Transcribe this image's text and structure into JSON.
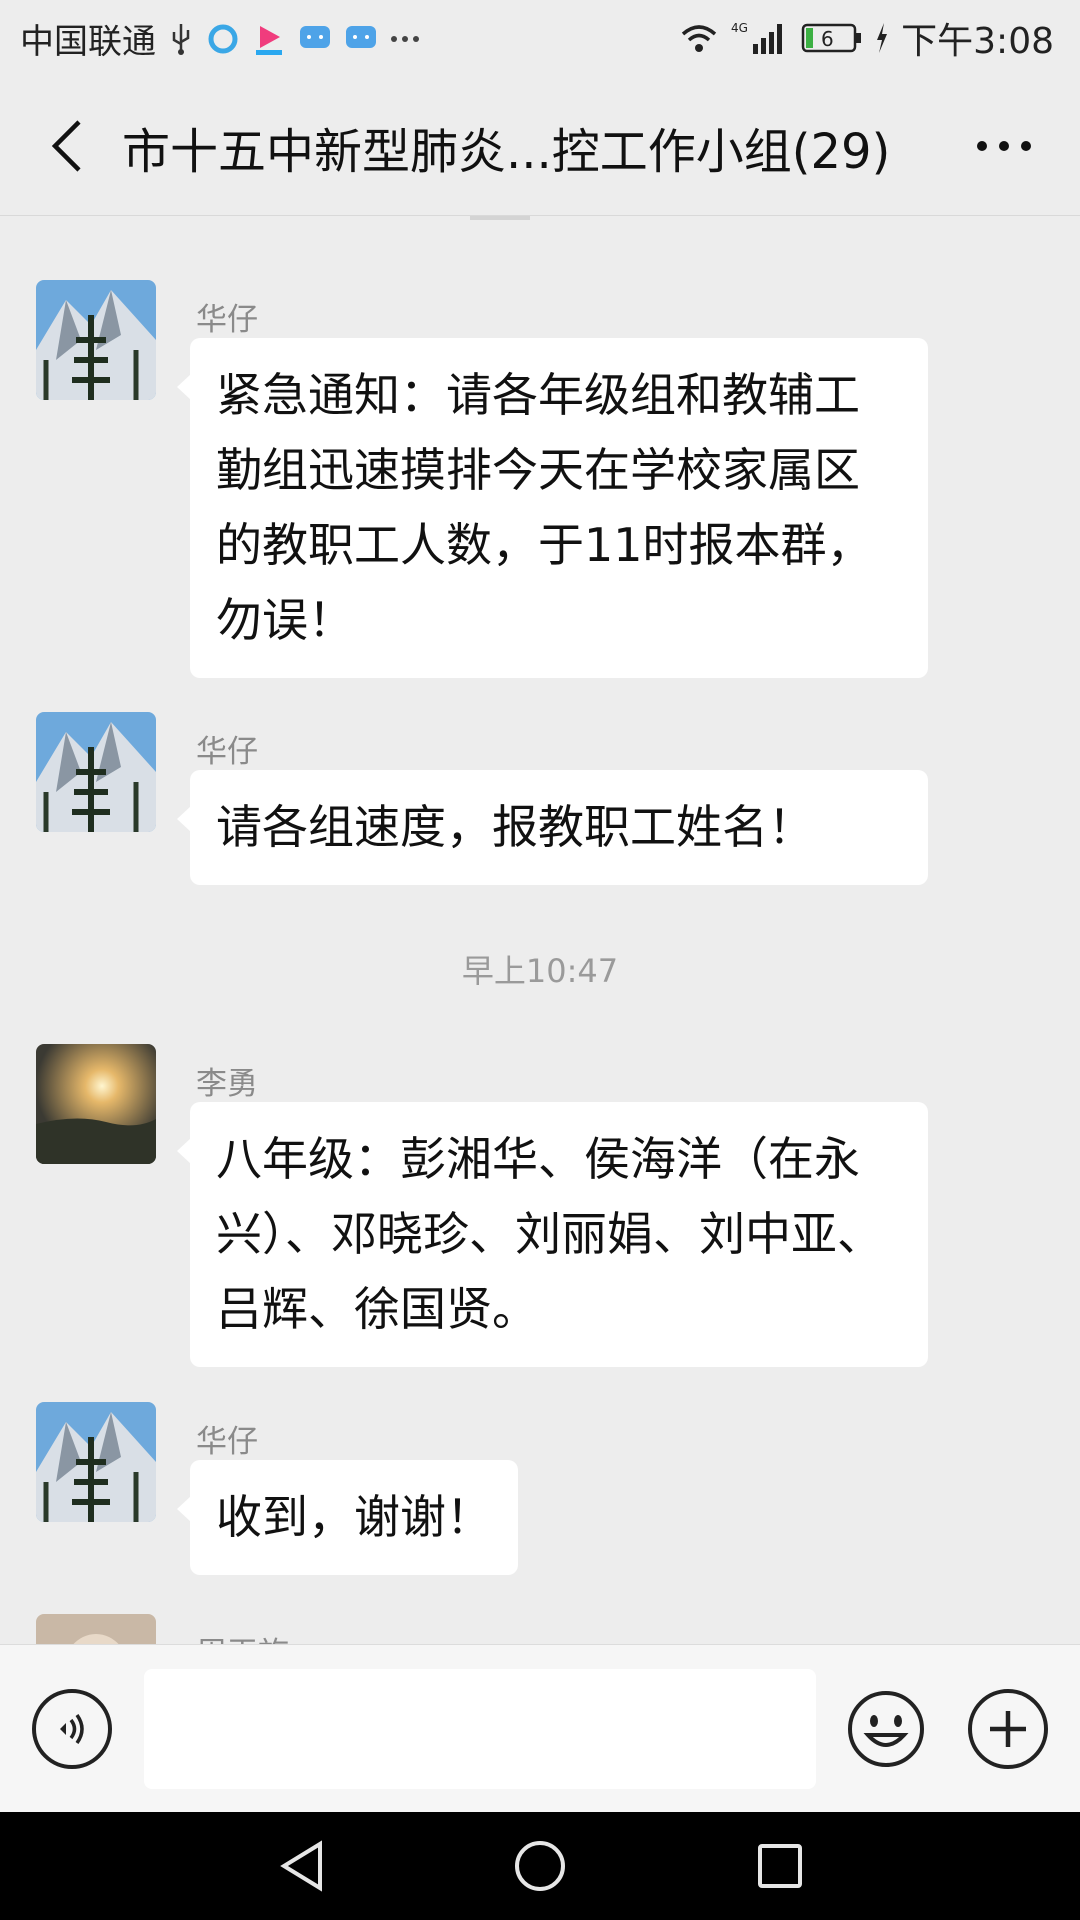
{
  "status_bar": {
    "carrier": "中国联通",
    "network": "4G",
    "battery": "6",
    "time": "下午3:08",
    "icons": [
      "usb-icon",
      "browser-app-icon",
      "youku-app-icon",
      "chat-app-icon",
      "chat-app-icon",
      "more-dots-icon",
      "wifi-icon",
      "signal-icon",
      "battery-icon",
      "charging-icon"
    ]
  },
  "header": {
    "title": "市十五中新型肺炎...控工作小组(29)",
    "back_icon": "chevron-left-icon",
    "more_icon": "more-horizontal-icon"
  },
  "messages": [
    {
      "sender": "华仔",
      "avatar": "mountain-trees-avatar",
      "text": "紧急通知：请各年级组和教辅工勤组迅速摸排今天在学校家属区的教职工人数，于11时报本群，勿误！"
    },
    {
      "sender": "华仔",
      "avatar": "mountain-trees-avatar",
      "text": "请各组速度，报教职工姓名！"
    },
    {
      "type": "timestamp",
      "text": "早上10:47"
    },
    {
      "sender": "李勇",
      "avatar": "sunset-avatar",
      "text": "八年级：彭湘华、侯海洋（在永兴）、邓晓珍、刘丽娟、刘中亚、吕辉、徐国贤。"
    },
    {
      "sender": "华仔",
      "avatar": "mountain-trees-avatar",
      "text": "收到，谢谢！"
    },
    {
      "sender": "周玉旋",
      "avatar": "portrait-avatar",
      "text": ""
    }
  ],
  "input_bar": {
    "voice_icon": "voice-icon",
    "input_value": "",
    "emoji_icon": "emoji-icon",
    "plus_icon": "plus-circle-icon"
  },
  "nav_bar": {
    "icons": [
      "back-triangle-icon",
      "home-circle-icon",
      "recent-square-icon"
    ]
  }
}
